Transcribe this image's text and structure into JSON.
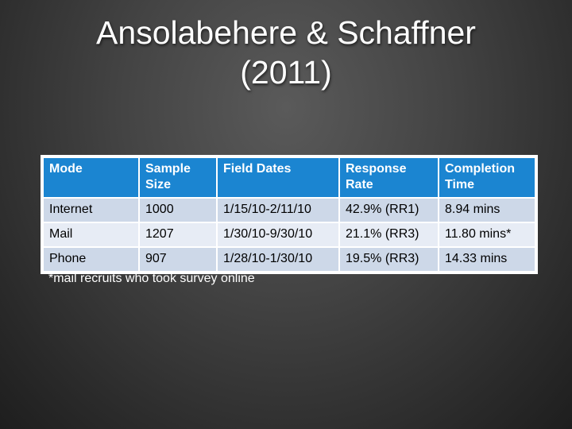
{
  "slide": {
    "title_line1": "Ansolabehere & Schaffner",
    "title_line2": "(2011)"
  },
  "table": {
    "headers": [
      "Mode",
      "Sample Size",
      "Field Dates",
      "Response Rate",
      "Completion Time"
    ],
    "rows": [
      [
        "Internet",
        "1000",
        "1/15/10-2/11/10",
        "42.9% (RR1)",
        "8.94 mins"
      ],
      [
        "Mail",
        "1207",
        "1/30/10-9/30/10",
        "21.1% (RR3)",
        "11.80 mins*"
      ],
      [
        "Phone",
        "907",
        "1/28/10-1/30/10",
        "19.5% (RR3)",
        "14.33 mins"
      ]
    ]
  },
  "footnote": "*mail recruits who took survey online",
  "colors": {
    "header_bg": "#1b85d1",
    "row_odd": "#cdd8e8",
    "row_even": "#e7ecf5"
  }
}
